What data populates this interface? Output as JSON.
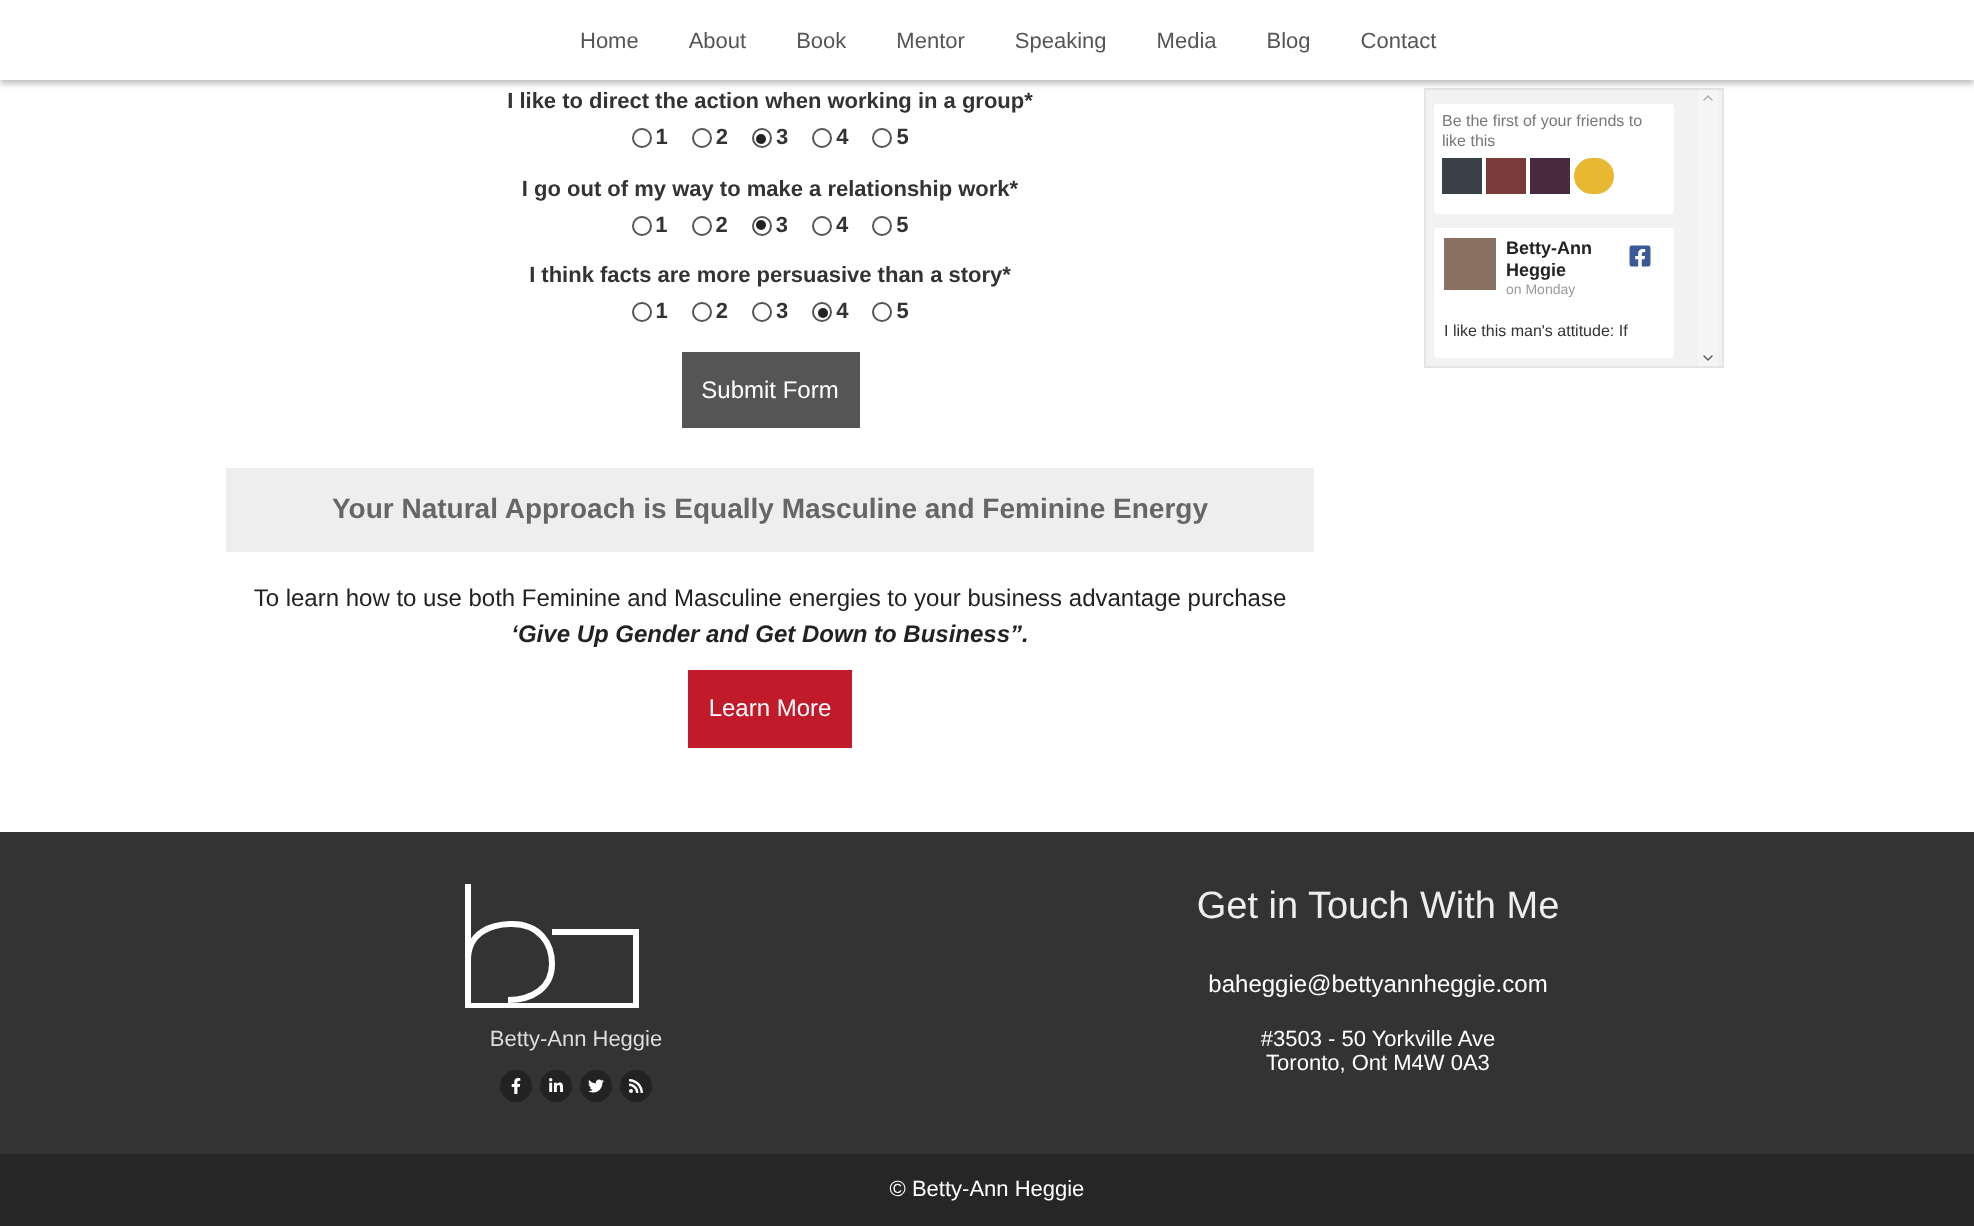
{
  "nav": {
    "items": [
      "Home",
      "About",
      "Book",
      "Mentor",
      "Speaking",
      "Media",
      "Blog",
      "Contact"
    ]
  },
  "questions": [
    {
      "text": "I like to direct the action when working in a group*",
      "options": [
        {
          "label": "1",
          "selected": false
        },
        {
          "label": "2",
          "selected": false
        },
        {
          "label": "3",
          "selected": true
        },
        {
          "label": "4",
          "selected": false
        },
        {
          "label": "5",
          "selected": false
        }
      ]
    },
    {
      "text": "I go out of my way to make a relationship work*",
      "options": [
        {
          "label": "1",
          "selected": false
        },
        {
          "label": "2",
          "selected": false
        },
        {
          "label": "3",
          "selected": true
        },
        {
          "label": "4",
          "selected": false
        },
        {
          "label": "5",
          "selected": false
        }
      ]
    },
    {
      "text": "I think facts are more persuasive than a story*",
      "options": [
        {
          "label": "1",
          "selected": false
        },
        {
          "label": "2",
          "selected": false
        },
        {
          "label": "3",
          "selected": false
        },
        {
          "label": "4",
          "selected": true
        },
        {
          "label": "5",
          "selected": false
        }
      ]
    }
  ],
  "submit_button": "Submit Form",
  "result": {
    "heading": "Your Natural Approach is Equally Masculine and Feminine Energy",
    "text": "To learn how to use both Feminine and Masculine energies to your business advantage purchase",
    "emphasis": "‘Give Up Gender and Get Down to Business”.",
    "button": "Learn More"
  },
  "facebook_widget": {
    "friends_text": "Be the first of your friends to like this",
    "post": {
      "author": "Betty-Ann Heggie",
      "time": "on Monday",
      "text": "I like this man's attitude: If"
    }
  },
  "footer": {
    "brand_name": "Betty-Ann Heggie",
    "contact_heading": "Get in Touch With Me",
    "email": "baheggie@bettyannheggie.com",
    "address_lines": [
      "#3503 - 50 Yorkville Ave",
      "Toronto, Ont M4W 0A3"
    ],
    "copyright": "© Betty-Ann Heggie"
  }
}
